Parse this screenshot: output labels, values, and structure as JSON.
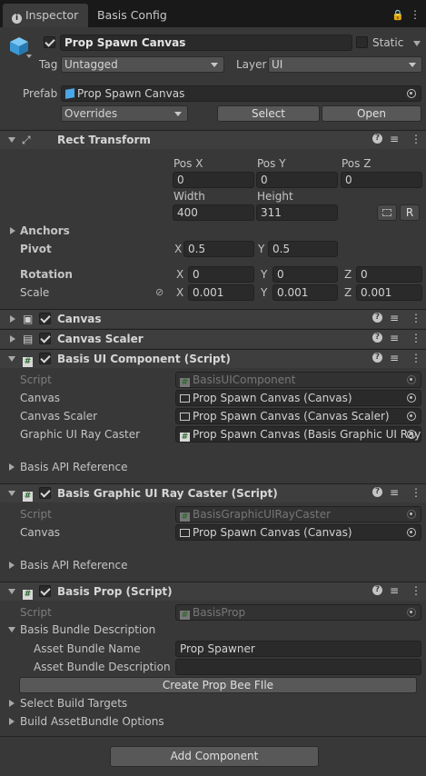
{
  "tabs": [
    {
      "label": "Inspector",
      "icon": "info-icon"
    },
    {
      "label": "Basis Config"
    }
  ],
  "object": {
    "name": "Prop Spawn Canvas",
    "static_label": "Static",
    "tag_label": "Tag",
    "tag_value": "Untagged",
    "layer_label": "Layer",
    "layer_value": "UI"
  },
  "prefab": {
    "label": "Prefab",
    "value": "Prop Spawn Canvas",
    "overrides": "Overrides",
    "select": "Select",
    "open": "Open"
  },
  "rect": {
    "title": "Rect Transform",
    "posx_label": "Pos X",
    "posy_label": "Pos Y",
    "posz_label": "Pos Z",
    "posx": "0",
    "posy": "0",
    "posz": "0",
    "width_label": "Width",
    "height_label": "Height",
    "width": "400",
    "height": "311",
    "r_button": "R",
    "anchors": "Anchors",
    "pivot": "Pivot",
    "pivot_x": "0.5",
    "pivot_y": "0.5",
    "rotation": "Rotation",
    "rot_x": "0",
    "rot_y": "0",
    "rot_z": "0",
    "scale": "Scale",
    "scale_x": "0.001",
    "scale_y": "0.001",
    "scale_z": "0.001",
    "x": "X",
    "y": "Y",
    "z": "Z"
  },
  "canvas": {
    "title": "Canvas"
  },
  "scaler": {
    "title": "Canvas Scaler"
  },
  "ui_component": {
    "title": "Basis UI Component (Script)",
    "script_label": "Script",
    "script_value": "BasisUIComponent",
    "canvas_label": "Canvas",
    "canvas_value": "Prop Spawn Canvas (Canvas)",
    "scaler_label": "Canvas Scaler",
    "scaler_value": "Prop Spawn Canvas (Canvas Scaler)",
    "ray_label": "Graphic UI Ray Caster",
    "ray_value": "Prop Spawn Canvas (Basis Graphic UI Ray",
    "api": "Basis API Reference"
  },
  "ray_caster": {
    "title": "Basis Graphic UI Ray Caster (Script)",
    "script_label": "Script",
    "script_value": "BasisGraphicUIRayCaster",
    "canvas_label": "Canvas",
    "canvas_value": "Prop Spawn Canvas (Canvas)",
    "api": "Basis API Reference"
  },
  "prop": {
    "title": "Basis Prop (Script)",
    "script_label": "Script",
    "script_value": "BasisProp",
    "bundle_desc": "Basis Bundle Description",
    "asset_name_label": "Asset Bundle Name",
    "asset_name_value": "Prop Spawner",
    "asset_desc_label": "Asset Bundle Description",
    "asset_desc_value": "",
    "create_button": "Create Prop Bee FIle",
    "build_targets": "Select Build Targets",
    "build_options": "Build AssetBundle Options"
  },
  "add_component": "Add Component",
  "colors": {
    "background": "#383838",
    "tabbar": "#191919",
    "field": "#2a2a2a",
    "header": "#3e3e3e",
    "cube": "#4aa8e8"
  }
}
